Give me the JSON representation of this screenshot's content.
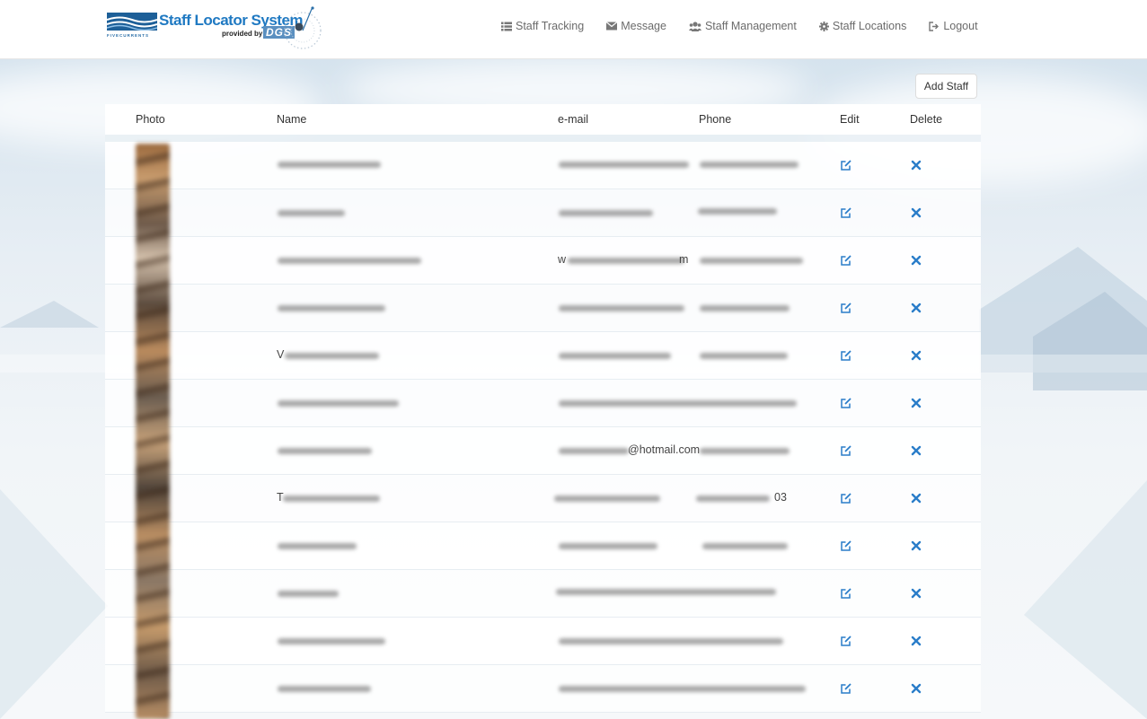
{
  "header": {
    "logo": {
      "title": "Staff Locator System",
      "subtitle": "provided by",
      "brand": "DGS",
      "fivecurrents": "FIVECURRENTS"
    },
    "nav": [
      {
        "label": "Staff Tracking",
        "icon": "list-icon"
      },
      {
        "label": "Message",
        "icon": "envelope-icon"
      },
      {
        "label": "Staff Management",
        "icon": "users-icon"
      },
      {
        "label": "Staff Locations",
        "icon": "gear-icon"
      },
      {
        "label": "Logout",
        "icon": "logout-icon"
      }
    ]
  },
  "toolbar": {
    "add_staff_label": "Add Staff"
  },
  "table": {
    "columns": [
      "Photo",
      "Name",
      "e-mail",
      "Phone",
      "Edit",
      "Delete"
    ],
    "rows": [
      {
        "name": "",
        "email": "",
        "phone": ""
      },
      {
        "name": "",
        "email": "",
        "phone": ""
      },
      {
        "name": "",
        "email": "w",
        "email_end": "m",
        "phone": ""
      },
      {
        "name": "",
        "email": "",
        "phone": ""
      },
      {
        "name": "V",
        "email": "",
        "phone": ""
      },
      {
        "name": "",
        "email": "",
        "phone": ""
      },
      {
        "name": "",
        "email": "@hotmail.com",
        "phone": ""
      },
      {
        "name": "T",
        "email": "",
        "phone": "03"
      },
      {
        "name": "",
        "email": "",
        "phone": ""
      },
      {
        "name": "",
        "email": "",
        "phone": ""
      },
      {
        "name": "",
        "email": "",
        "phone": ""
      },
      {
        "name": "",
        "email": "",
        "phone": ""
      }
    ]
  },
  "colors": {
    "accent": "#1f79c2",
    "icon_blue": "#2a7dc9",
    "nav_text": "#6b6b6b"
  }
}
